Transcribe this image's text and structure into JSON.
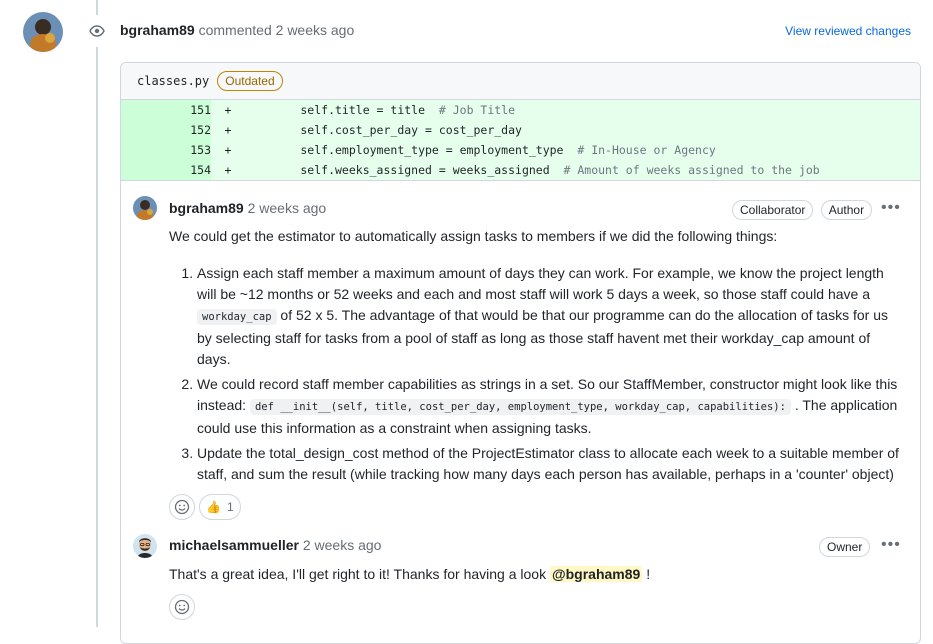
{
  "header": {
    "author": "bgraham89",
    "action": "commented",
    "time": "2 weeks ago",
    "view_link": "View reviewed changes"
  },
  "file": {
    "name": "classes.py",
    "badge": "Outdated",
    "lines": [
      {
        "num": "151",
        "sign": "+",
        "code": "        self.title = title  ",
        "comment": "# Job Title"
      },
      {
        "num": "152",
        "sign": "+",
        "code": "        self.cost_per_day = cost_per_day",
        "comment": ""
      },
      {
        "num": "153",
        "sign": "+",
        "code": "        self.employment_type = employment_type  ",
        "comment": "# In-House or Agency"
      },
      {
        "num": "154",
        "sign": "+",
        "code": "        self.weeks_assigned = weeks_assigned  ",
        "comment": "# Amount of weeks assigned to the job"
      }
    ]
  },
  "comments": [
    {
      "author": "bgraham89",
      "time": "2 weeks ago",
      "labels": [
        "Collaborator",
        "Author"
      ],
      "intro": "We could get the estimator to automatically assign tasks to members if we did the following things:",
      "item1_a": "Assign each staff member a maximum amount of days they can work. For example, we know the project length will be ~12 months or 52 weeks and each and most staff will work 5 days a week, so those staff could have a ",
      "item1_code": "workday_cap",
      "item1_b": " of 52 x 5. The advantage of that would be that our programme can do the allocation of tasks for us by selecting staff for tasks from a pool of staff as long as those staff havent met their workday_cap amount of days.",
      "item2_a": "We could record staff member capabilities as strings in a set. So our StaffMember, constructor might look like this instead: ",
      "item2_code": "def __init__(self, title, cost_per_day, employment_type, workday_cap, capabilities):",
      "item2_b": " . The application could use this information as a constraint when assigning tasks.",
      "item3": "Update the total_design_cost method of the ProjectEstimator class to allocate each week to a suitable member of staff, and sum the result (while tracking how many days each person has available, perhaps in a 'counter' object)",
      "reaction_emoji": "👍",
      "reaction_count": "1"
    },
    {
      "author": "michaelsammueller",
      "time": "2 weeks ago",
      "labels": [
        "Owner"
      ],
      "text": "That's a great idea, I'll get right to it! Thanks for having a look ",
      "mention": "@bgraham89",
      "text_end": " !"
    }
  ],
  "icons": {
    "eye": "eye-icon",
    "smiley": "smiley-icon",
    "kebab": "kebab-horizontal-icon"
  },
  "colors": {
    "link": "#0969da",
    "diff_add_bg": "#e6ffec",
    "diff_num_bg": "#ccffd8",
    "outdated": "#9a6700",
    "mention_bg": "#fff8c5"
  }
}
